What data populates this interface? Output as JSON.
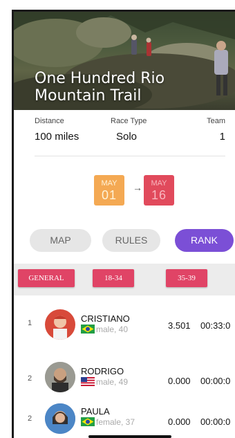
{
  "event": {
    "title_line1": "One Hundred Rio",
    "title_line2": "Mountain Trail"
  },
  "info": {
    "distance_label": "Distance",
    "distance_value": "100 miles",
    "race_type_label": "Race Type",
    "race_type_value": "Solo",
    "team_label": "Team",
    "team_value": "1"
  },
  "dates": {
    "start_month": "MAY",
    "start_day": "01",
    "end_month": "MAY",
    "end_day": "16",
    "arrow": "→"
  },
  "tabs": [
    {
      "label": "MAP",
      "active": false
    },
    {
      "label": "RULES",
      "active": false
    },
    {
      "label": "RANK",
      "active": true
    }
  ],
  "groups": [
    "GENERAL",
    "18-34",
    "35-39"
  ],
  "ranking": [
    {
      "position": "1",
      "name": "CRISTIANO",
      "details": "male, 40",
      "flag": "brazil-flag",
      "score": "3.501",
      "time": "00:33:0"
    },
    {
      "position": "2",
      "name": "RODRIGO",
      "details": "male, 49",
      "flag": "usa-flag",
      "score": "0.000",
      "time": "00:00:0"
    },
    {
      "position": "2",
      "name": "PAULA",
      "details": "female, 37",
      "flag": "brazil-flag",
      "score": "0.000",
      "time": "00:00:0"
    }
  ],
  "colors": {
    "accent": "#7b4fd6",
    "group_button": "#e04466",
    "start_date_bg": "#f4a953",
    "end_date_bg": "#e14a5c"
  }
}
